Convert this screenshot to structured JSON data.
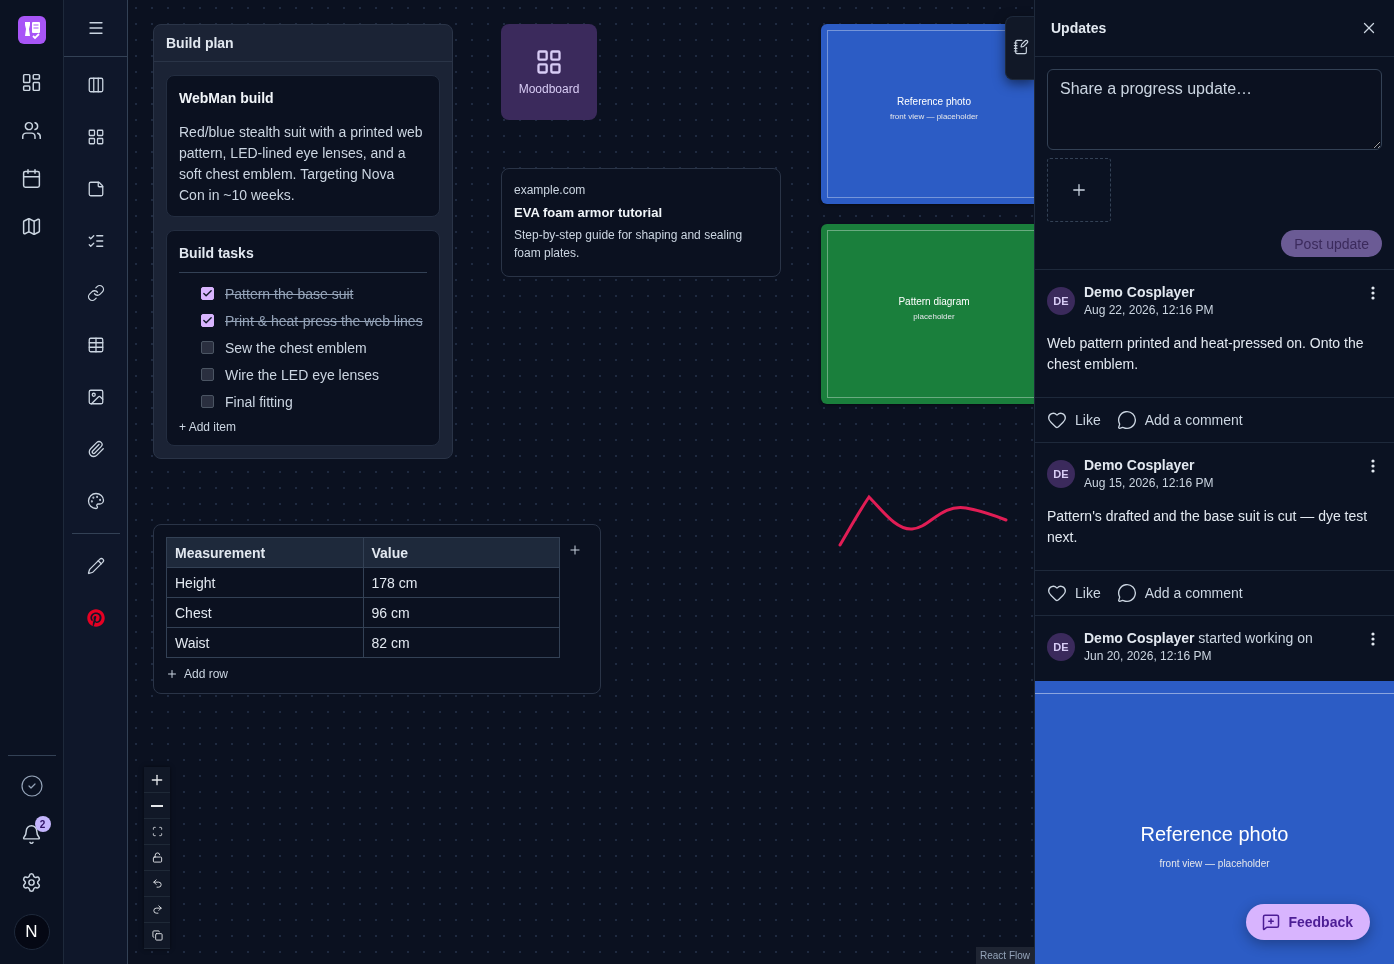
{
  "rail": {
    "notification_count": "2",
    "avatar": "N"
  },
  "canvas": {
    "build_plan": {
      "title": "Build plan",
      "note": {
        "title": "WebMan build",
        "body": "Red/blue stealth suit with a printed web pattern, LED-lined eye lenses, and a soft chest emblem. Targeting Nova Con in ~10 weeks."
      },
      "checklist": {
        "title": "Build tasks",
        "add_label": "+ Add item",
        "items": [
          {
            "label": "Pattern the base suit",
            "checked": true
          },
          {
            "label": "Print & heat-press the web lines",
            "checked": true
          },
          {
            "label": "Sew the chest emblem",
            "checked": false
          },
          {
            "label": "Wire the LED eye lenses",
            "checked": false
          },
          {
            "label": "Final fitting",
            "checked": false
          }
        ]
      }
    },
    "moodboard": {
      "label": "Moodboard"
    },
    "link": {
      "domain": "example.com",
      "title": "EVA foam armor tutorial",
      "description": "Step-by-step guide for shaping and sealing foam plates."
    },
    "images": [
      {
        "title": "Reference photo",
        "caption": "front view — placeholder",
        "color": "#2c5cc5"
      },
      {
        "title": "Pattern diagram",
        "caption": "placeholder",
        "color": "#1a7f3c"
      }
    ],
    "table": {
      "columns": [
        "Measurement",
        "Value"
      ],
      "rows": [
        [
          "Height",
          "178 cm"
        ],
        [
          "Chest",
          "96 cm"
        ],
        [
          "Waist",
          "82 cm"
        ]
      ],
      "add_label": "Add row"
    },
    "attribution": "React Flow"
  },
  "updates": {
    "title": "Updates",
    "composer": {
      "placeholder": "Share a progress update…",
      "button": "Post update"
    },
    "posts": [
      {
        "kind": "update",
        "avatar": "DE",
        "author": "Demo Cosplayer",
        "time": "Aug 22, 2026, 12:16 PM",
        "body": "Web pattern printed and heat-pressed on. Onto the chest emblem.",
        "like": "Like",
        "comment": "Add a comment"
      },
      {
        "kind": "update",
        "avatar": "DE",
        "author": "Demo Cosplayer",
        "time": "Aug 15, 2026, 12:16 PM",
        "body": "Pattern's drafted and the base suit is cut — dye test next.",
        "like": "Like",
        "comment": "Add a comment"
      },
      {
        "kind": "activity",
        "avatar": "DE",
        "headline": "**Demo Cosplayer** started working on",
        "time": "Jun 20, 2026, 12:16 PM",
        "attachment": {
          "title": "Reference photo",
          "caption": "front view — placeholder",
          "color": "#2c5cc5"
        }
      }
    ],
    "feedback": "Feedback"
  }
}
